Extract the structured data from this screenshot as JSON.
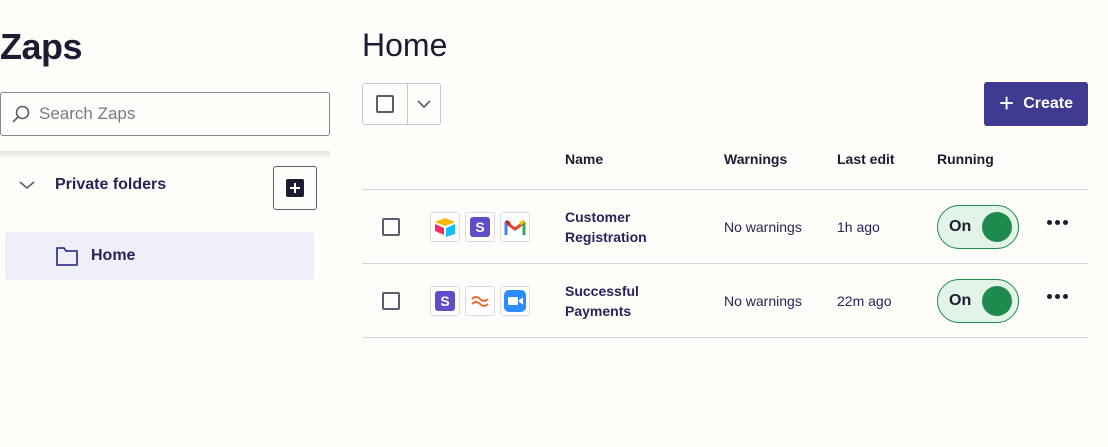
{
  "sidebar": {
    "title": "Zaps",
    "search_placeholder": "Search Zaps",
    "section_label": "Private folders",
    "folders": [
      {
        "label": "Home",
        "selected": true
      }
    ]
  },
  "main": {
    "title": "Home",
    "create_label": "Create",
    "columns": {
      "name": "Name",
      "warnings": "Warnings",
      "last_edit": "Last edit",
      "running": "Running"
    },
    "rows": [
      {
        "name": "Customer Registration",
        "warnings": "No warnings",
        "last_edit": "1h ago",
        "status": "On",
        "apps": [
          "airtable-icon",
          "stripe-icon",
          "gmail-icon"
        ]
      },
      {
        "name": "Successful Payments",
        "warnings": "No warnings",
        "last_edit": "22m ago",
        "status": "On",
        "apps": [
          "stripe-icon",
          "wave-icon",
          "zoom-icon"
        ]
      }
    ]
  },
  "colors": {
    "accent": "#3d3a8f",
    "toggle_on": "#1e8a4d",
    "toggle_bg": "#e2f3e8",
    "selected_bg": "#eeeff9",
    "background": "#fffdf9"
  }
}
